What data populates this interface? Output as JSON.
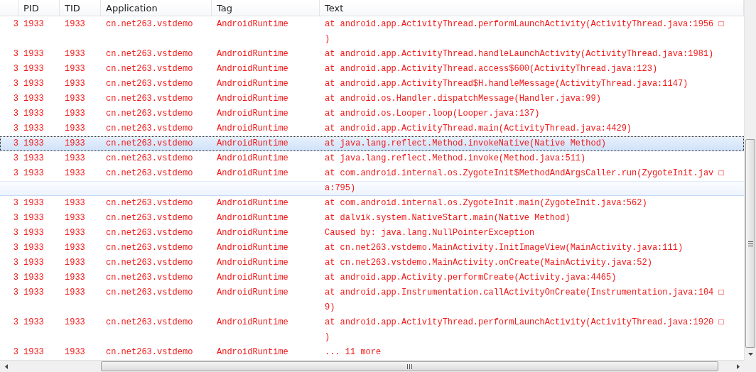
{
  "table": {
    "columns": [
      "",
      "PID",
      "TID",
      "Application",
      "Tag",
      "Text"
    ],
    "rows": [
      {
        "column_1": "3",
        "pid": "1933",
        "tid": "1933",
        "application": "cn.net263.vstdemo",
        "tag": "AndroidRuntime",
        "selected": false,
        "hovered": false,
        "text": [
          "at android.app.ActivityThread.performLaunchActivity(ActivityThread.java:1956 □",
          ")"
        ]
      },
      {
        "column_1": "3",
        "pid": "1933",
        "tid": "1933",
        "application": "cn.net263.vstdemo",
        "tag": "AndroidRuntime",
        "selected": false,
        "hovered": false,
        "text": [
          "at android.app.ActivityThread.handleLaunchActivity(ActivityThread.java:1981)"
        ]
      },
      {
        "column_1": "3",
        "pid": "1933",
        "tid": "1933",
        "application": "cn.net263.vstdemo",
        "tag": "AndroidRuntime",
        "selected": false,
        "hovered": false,
        "text": [
          "at android.app.ActivityThread.access$600(ActivityThread.java:123)"
        ]
      },
      {
        "column_1": "3",
        "pid": "1933",
        "tid": "1933",
        "application": "cn.net263.vstdemo",
        "tag": "AndroidRuntime",
        "selected": false,
        "hovered": false,
        "text": [
          "at android.app.ActivityThread$H.handleMessage(ActivityThread.java:1147)"
        ]
      },
      {
        "column_1": "3",
        "pid": "1933",
        "tid": "1933",
        "application": "cn.net263.vstdemo",
        "tag": "AndroidRuntime",
        "selected": false,
        "hovered": false,
        "text": [
          "at android.os.Handler.dispatchMessage(Handler.java:99)"
        ]
      },
      {
        "column_1": "3",
        "pid": "1933",
        "tid": "1933",
        "application": "cn.net263.vstdemo",
        "tag": "AndroidRuntime",
        "selected": false,
        "hovered": false,
        "text": [
          "at android.os.Looper.loop(Looper.java:137)"
        ]
      },
      {
        "column_1": "3",
        "pid": "1933",
        "tid": "1933",
        "application": "cn.net263.vstdemo",
        "tag": "AndroidRuntime",
        "selected": false,
        "hovered": false,
        "text": [
          "at android.app.ActivityThread.main(ActivityThread.java:4429)"
        ]
      },
      {
        "column_1": "3",
        "pid": "1933",
        "tid": "1933",
        "application": "cn.net263.vstdemo",
        "tag": "AndroidRuntime",
        "selected": true,
        "hovered": false,
        "text": [
          "at java.lang.reflect.Method.invokeNative(Native Method)"
        ]
      },
      {
        "column_1": "3",
        "pid": "1933",
        "tid": "1933",
        "application": "cn.net263.vstdemo",
        "tag": "AndroidRuntime",
        "selected": false,
        "hovered": false,
        "text": [
          "at java.lang.reflect.Method.invoke(Method.java:511)"
        ]
      },
      {
        "column_1": "3",
        "pid": "1933",
        "tid": "1933",
        "application": "cn.net263.vstdemo",
        "tag": "AndroidRuntime",
        "selected": false,
        "hovered": true,
        "text": [
          "at com.android.internal.os.ZygoteInit$MethodAndArgsCaller.run(ZygoteInit.jav □",
          "a:795)"
        ]
      },
      {
        "column_1": "3",
        "pid": "1933",
        "tid": "1933",
        "application": "cn.net263.vstdemo",
        "tag": "AndroidRuntime",
        "selected": false,
        "hovered": false,
        "text": [
          "at com.android.internal.os.ZygoteInit.main(ZygoteInit.java:562)"
        ]
      },
      {
        "column_1": "3",
        "pid": "1933",
        "tid": "1933",
        "application": "cn.net263.vstdemo",
        "tag": "AndroidRuntime",
        "selected": false,
        "hovered": false,
        "text": [
          "at dalvik.system.NativeStart.main(Native Method)"
        ]
      },
      {
        "column_1": "3",
        "pid": "1933",
        "tid": "1933",
        "application": "cn.net263.vstdemo",
        "tag": "AndroidRuntime",
        "selected": false,
        "hovered": false,
        "text": [
          "Caused by: java.lang.NullPointerException"
        ]
      },
      {
        "column_1": "3",
        "pid": "1933",
        "tid": "1933",
        "application": "cn.net263.vstdemo",
        "tag": "AndroidRuntime",
        "selected": false,
        "hovered": false,
        "text": [
          "at cn.net263.vstdemo.MainActivity.InitImageView(MainActivity.java:111)"
        ]
      },
      {
        "column_1": "3",
        "pid": "1933",
        "tid": "1933",
        "application": "cn.net263.vstdemo",
        "tag": "AndroidRuntime",
        "selected": false,
        "hovered": false,
        "text": [
          "at cn.net263.vstdemo.MainActivity.onCreate(MainActivity.java:52)"
        ]
      },
      {
        "column_1": "3",
        "pid": "1933",
        "tid": "1933",
        "application": "cn.net263.vstdemo",
        "tag": "AndroidRuntime",
        "selected": false,
        "hovered": false,
        "text": [
          "at android.app.Activity.performCreate(Activity.java:4465)"
        ]
      },
      {
        "column_1": "3",
        "pid": "1933",
        "tid": "1933",
        "application": "cn.net263.vstdemo",
        "tag": "AndroidRuntime",
        "selected": false,
        "hovered": false,
        "text": [
          "at android.app.Instrumentation.callActivityOnCreate(Instrumentation.java:104 □",
          "9)"
        ]
      },
      {
        "column_1": "3",
        "pid": "1933",
        "tid": "1933",
        "application": "cn.net263.vstdemo",
        "tag": "AndroidRuntime",
        "selected": false,
        "hovered": false,
        "text": [
          "at android.app.ActivityThread.performLaunchActivity(ActivityThread.java:1920 □",
          ")"
        ]
      },
      {
        "column_1": "3",
        "pid": "1933",
        "tid": "1933",
        "application": "cn.net263.vstdemo",
        "tag": "AndroidRuntime",
        "selected": false,
        "hovered": false,
        "text": [
          "... 11 more"
        ]
      }
    ]
  }
}
